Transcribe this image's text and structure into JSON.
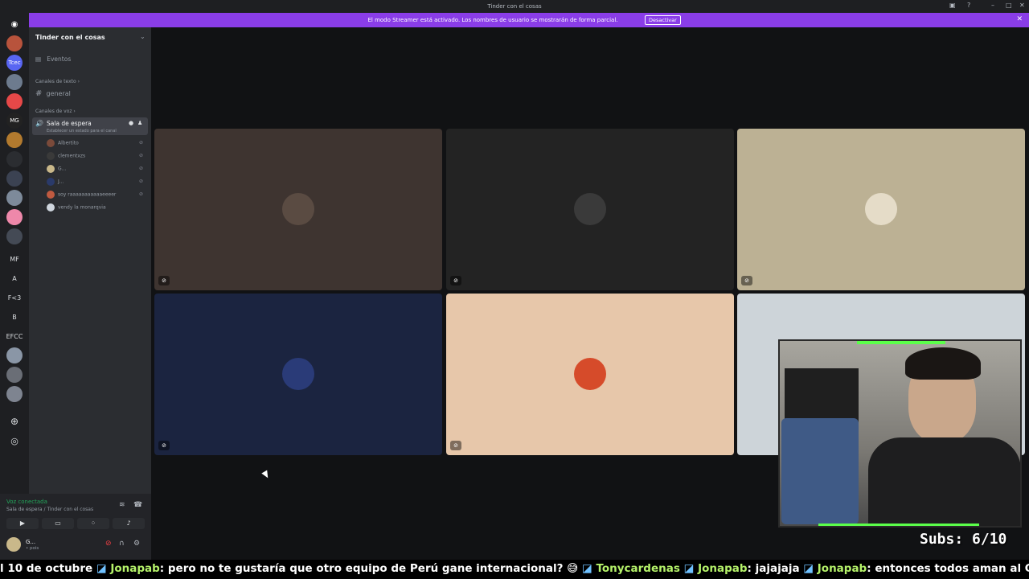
{
  "window": {
    "title": "Tinder con el cosas"
  },
  "banner": {
    "message": "El modo Streamer está activado. Los nombres de usuario se mostrarán de forma parcial.",
    "button": "Desactivar"
  },
  "servers": [
    {
      "label": "",
      "color": "#b8533c"
    },
    {
      "label": "Tcec",
      "color": "#5865f2"
    },
    {
      "label": "",
      "color": "#6d7b8e"
    },
    {
      "label": "",
      "color": "#e64848"
    },
    {
      "label": "MG",
      "color": "#222222"
    },
    {
      "label": "",
      "color": "#b27a2e"
    },
    {
      "label": "",
      "color": "#2b2d31"
    },
    {
      "label": "",
      "color": "#3b4252"
    },
    {
      "label": "",
      "color": "#7d8a9a"
    },
    {
      "label": "",
      "color": "#ee88aa"
    },
    {
      "label": "",
      "color": "#444a55"
    },
    {
      "label": "MF",
      "color": ""
    },
    {
      "label": "A",
      "color": ""
    },
    {
      "label": "F<3",
      "color": ""
    },
    {
      "label": "B",
      "color": ""
    },
    {
      "label": "EFCC",
      "color": ""
    },
    {
      "label": "",
      "color": "#8a96a6"
    },
    {
      "label": "",
      "color": "#6a6e76"
    },
    {
      "label": "",
      "color": "#7e8490"
    }
  ],
  "sidebar": {
    "server_name": "Tinder con el cosas",
    "events": "Eventos",
    "text_category": "Canales de texto",
    "text_channel": "general",
    "voice_category": "Canales de voz",
    "voice_channel": "Sala de espera",
    "voice_status": "Establecer un estado para el canal",
    "voice_users": [
      {
        "name": "Albertito",
        "color": "#7a4a3a"
      },
      {
        "name": "clementxzs",
        "color": "#3a3a3a"
      },
      {
        "name": "G...",
        "color": "#c9b88a"
      },
      {
        "name": "J...",
        "color": "#2a3a6a"
      },
      {
        "name": "soy raaaaaaaaaaaeeeer",
        "color": "#c05a40"
      },
      {
        "name": "vendy la monarqvia",
        "color": "#cfd6de"
      }
    ]
  },
  "voice_panel": {
    "status": "Voz conectada",
    "location": "Sala de espera / Tinder con el cosas"
  },
  "user": {
    "name": "G...",
    "status": "• pois"
  },
  "tiles": [
    {
      "bg": "#3e3430",
      "avatar": "#5a4b42"
    },
    {
      "bg": "#232323",
      "avatar": "#3a3a3a"
    },
    {
      "bg": "#bcb194",
      "avatar": "#e5dcc8"
    },
    {
      "bg": "#1b2440",
      "avatar": "#2a3b78"
    },
    {
      "bg": "#e7c7aa",
      "avatar": "#d64b2a"
    },
    {
      "bg": "#cdd4d9",
      "avatar": "#cdd4d9"
    }
  ],
  "overlay": {
    "subs": "Subs: 6/10"
  },
  "ticker": {
    "items": [
      {
        "name": "",
        "text": "l 10 de octubre"
      },
      {
        "name": "Jonapab",
        "text": ": pero no te gustaría que otro equipo de Perú gane internacional? 😅"
      },
      {
        "name": "Tonycardenas",
        "text": ""
      },
      {
        "name": "Jonapab",
        "text": ": jajajaja"
      },
      {
        "name": "Jonapab",
        "text": ": entonces todos aman al Cienciano"
      }
    ]
  }
}
